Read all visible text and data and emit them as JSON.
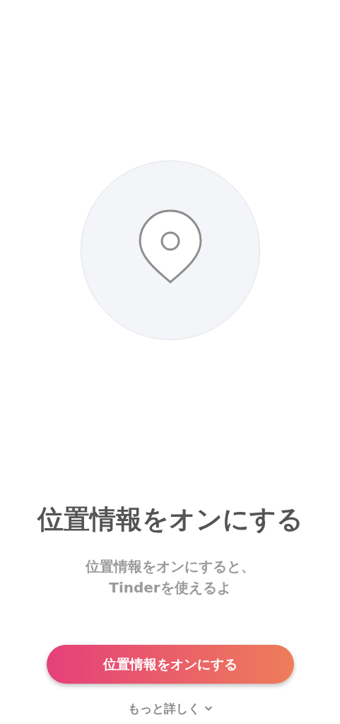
{
  "title": "位置情報をオンにする",
  "description_lines": [
    "位置情報をオンにすると、",
    "Tinderを使えるよ"
  ],
  "primary_button": "位置情報をオンにする",
  "more_link": "もっと詳しく"
}
